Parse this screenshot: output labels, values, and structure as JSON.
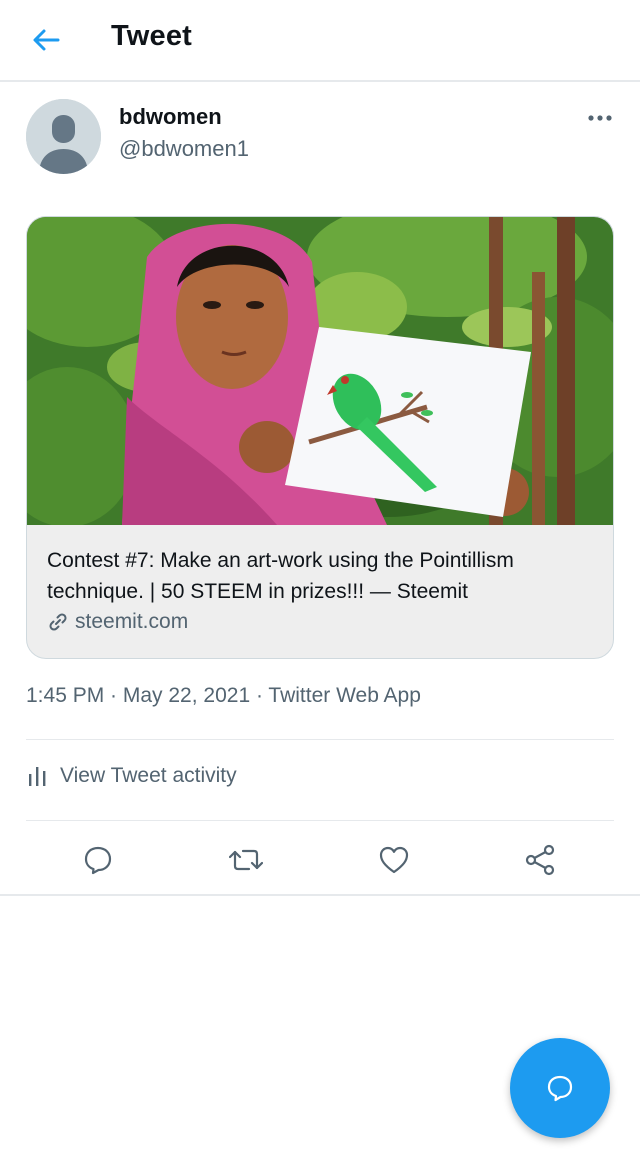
{
  "header": {
    "title": "Tweet",
    "back_icon": "arrow-left-icon"
  },
  "tweet": {
    "display_name": "bdwomen",
    "handle": "@bdwomen1",
    "more_icon": "more-dots-icon",
    "card": {
      "image_alt": "Woman in pink scarf holding a drawing of a green parrot",
      "title": "Contest #7: Make an art-work using the Pointillism technique. | 50 STEEM in prizes!!! — Steemit",
      "domain": "steemit.com",
      "link_icon": "link-icon"
    },
    "timestamp": "1:45 PM · May 22, 2021 · Twitter Web App",
    "activity_label": "View Tweet activity",
    "actions": [
      "reply-icon",
      "retweet-icon",
      "like-icon",
      "share-icon"
    ]
  },
  "fab": {
    "icon": "compose-reply-icon"
  },
  "colors": {
    "accent": "#1d9bf0",
    "secondary_text": "#536471",
    "divider": "#e6e9ec"
  }
}
